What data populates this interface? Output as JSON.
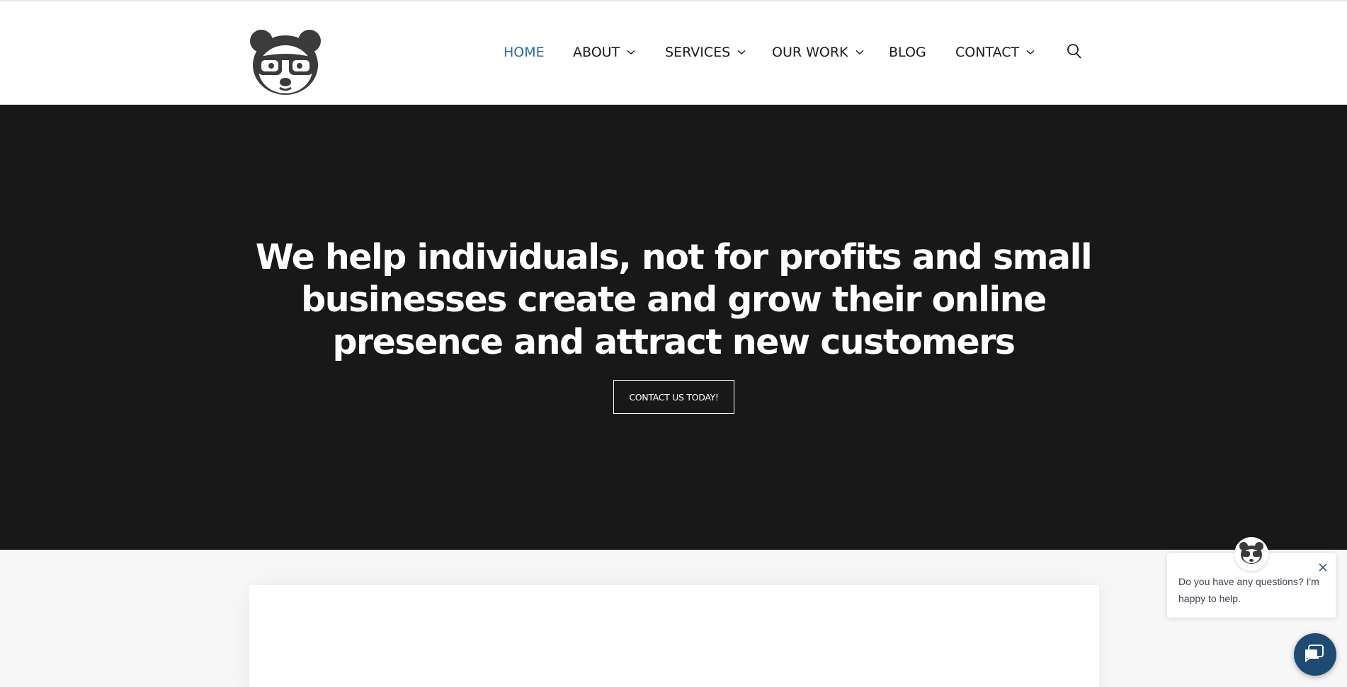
{
  "colors": {
    "header_bg": "#ffffff",
    "nav_text": "#1a1a1a",
    "nav_active": "#2e6aa6",
    "hero_bg": "#181818",
    "hero_text": "#ffffff",
    "page_bg": "#f7f7f7",
    "chat_launcher": "#1e4a73"
  },
  "header": {
    "logo_icon": "panda-with-glasses-logo",
    "nav": [
      {
        "label": "HOME",
        "active": true,
        "has_dropdown": false
      },
      {
        "label": "ABOUT",
        "active": false,
        "has_dropdown": true
      },
      {
        "label": "SERVICES",
        "active": false,
        "has_dropdown": true
      },
      {
        "label": "OUR WORK",
        "active": false,
        "has_dropdown": true
      },
      {
        "label": "BLOG",
        "active": false,
        "has_dropdown": false
      },
      {
        "label": "CONTACT",
        "active": false,
        "has_dropdown": true
      }
    ],
    "search_icon": "search-icon"
  },
  "hero": {
    "title": "We help individuals, not for profits and small businesses create and grow their online presence and attract new customers",
    "cta_label": "CONTACT US TODAY!"
  },
  "chat": {
    "message": "Do you have any questions? I'm happy to help.",
    "avatar_icon": "panda-avatar-icon",
    "close_icon": "close-icon",
    "launcher_icon": "chat-bubble-icon"
  }
}
